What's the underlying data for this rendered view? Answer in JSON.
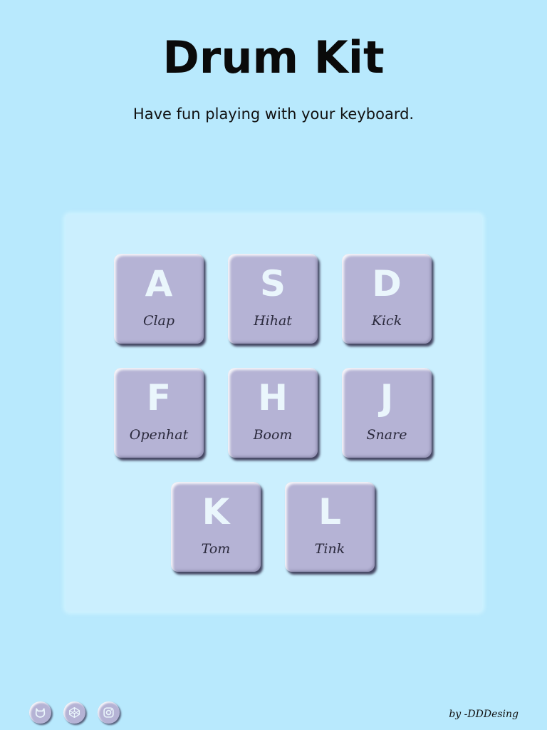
{
  "header": {
    "title": "Drum Kit",
    "subtitle": "Have fun playing with your keyboard."
  },
  "keys": [
    {
      "letter": "A",
      "sound": "Clap"
    },
    {
      "letter": "S",
      "sound": "Hihat"
    },
    {
      "letter": "D",
      "sound": "Kick"
    },
    {
      "letter": "F",
      "sound": "Openhat"
    },
    {
      "letter": "H",
      "sound": "Boom"
    },
    {
      "letter": "J",
      "sound": "Snare"
    },
    {
      "letter": "K",
      "sound": "Tom"
    },
    {
      "letter": "L",
      "sound": "Tink"
    }
  ],
  "footer": {
    "social_icons": [
      "github-icon",
      "codepen-icon",
      "instagram-icon"
    ],
    "credit": "by -DDDesing"
  },
  "colors": {
    "background": "#b8e9fd",
    "panel": "#cbeffe",
    "key": "#b5b3d5",
    "key_letter": "#eaf6fc",
    "key_sound": "#2b2a3d"
  }
}
